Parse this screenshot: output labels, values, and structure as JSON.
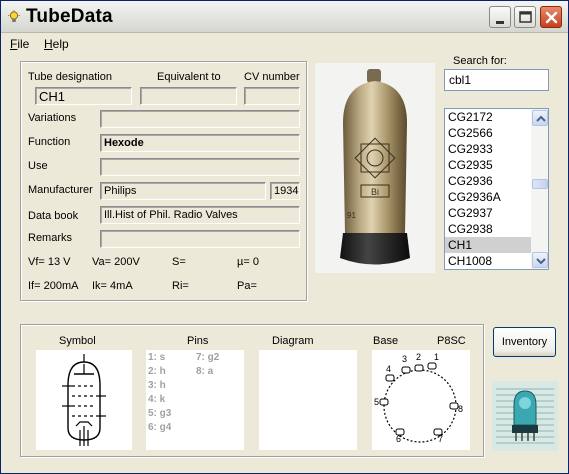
{
  "window": {
    "title": "TubeData"
  },
  "menu": {
    "file": "File",
    "file_key": "F",
    "file_rest": "ile",
    "help_key": "H",
    "help_rest": "elp"
  },
  "details": {
    "designation_label": "Tube designation",
    "equivalent_label": "Equivalent to",
    "cv_label": "CV number",
    "designation": "CH1",
    "equivalent": "",
    "cv_number": "",
    "variations_label": "Variations",
    "variations": "",
    "function_label": "Function",
    "function": "Hexode",
    "use_label": "Use",
    "use": "",
    "manufacturer_label": "Manufacturer",
    "manufacturer": "Philips",
    "year": "1934",
    "databook_label": "Data book",
    "databook": "Ill.Hist of Phil. Radio Valves",
    "remarks_label": "Remarks",
    "remarks": ""
  },
  "params": {
    "vf": "Vf= 13 V",
    "va": "Va= 200V",
    "s": "S=",
    "mu": "µ=   0",
    "if": "If= 200mA",
    "ik": "Ik=  4mA",
    "ri": "Ri=",
    "pa": "Pa="
  },
  "search": {
    "label": "Search for:",
    "value": "cbl1"
  },
  "results": [
    {
      "label": "CG2172",
      "selected": false
    },
    {
      "label": "CG2566",
      "selected": false
    },
    {
      "label": "CG2933",
      "selected": false
    },
    {
      "label": "CG2935",
      "selected": false
    },
    {
      "label": "CG2936",
      "selected": false
    },
    {
      "label": "CG2936A",
      "selected": false
    },
    {
      "label": "CG2937",
      "selected": false
    },
    {
      "label": "CG2938",
      "selected": false
    },
    {
      "label": "CH1",
      "selected": true
    },
    {
      "label": "CH1008",
      "selected": false
    }
  ],
  "bottom": {
    "symbol_label": "Symbol",
    "pins_label": "Pins",
    "diagram_label": "Diagram",
    "base_label": "Base",
    "base_type": "P8SC",
    "pins_left": [
      "1: s",
      "2: h",
      "3: h",
      "4: k",
      "5: g3",
      "6: g4"
    ],
    "pins_right": [
      "7: g2",
      "8: a"
    ],
    "base_numbers": [
      "1",
      "2",
      "3",
      "4",
      "5",
      "6",
      "7",
      "8"
    ]
  },
  "buttons": {
    "inventory": "Inventory"
  },
  "icons": {
    "app": "lightbulb-icon",
    "minimize": "minimize-icon",
    "maximize": "maximize-icon",
    "close": "close-icon",
    "scroll_up": "chevron-up-icon",
    "scroll_down": "chevron-down-icon"
  },
  "colors": {
    "title_bg": "#e6e6e2",
    "close_btn": "#c8401c",
    "selection": "#d0d0d0",
    "window_bg": "#ece9d8"
  }
}
